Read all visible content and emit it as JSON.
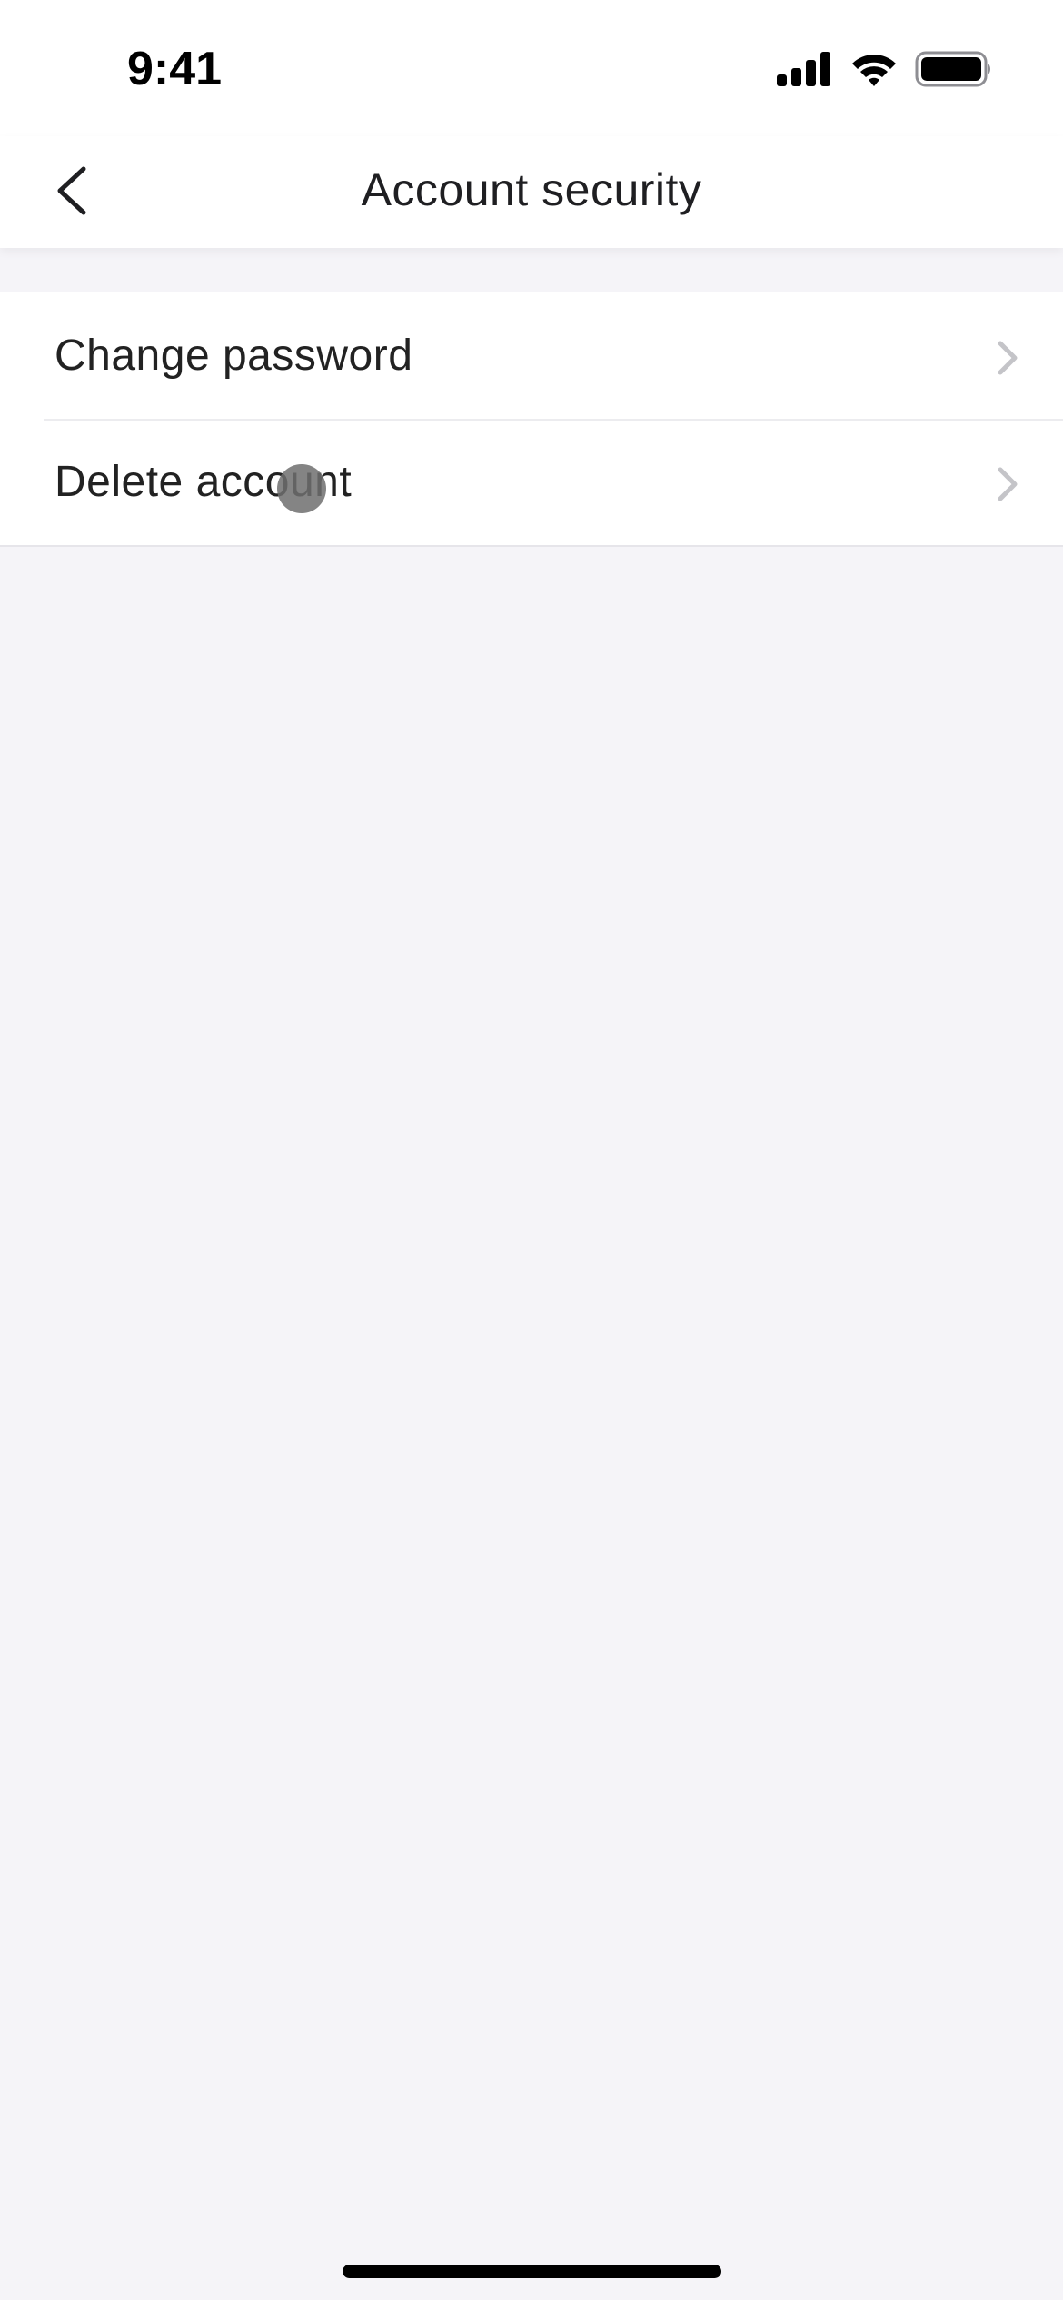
{
  "status_bar": {
    "time": "9:41",
    "icons": [
      "cellular-signal-icon",
      "wifi-icon",
      "battery-icon"
    ]
  },
  "nav": {
    "title": "Account security",
    "back_icon": "chevron-left-icon"
  },
  "settings_list": {
    "items": [
      {
        "label": "Change password",
        "icon": "chevron-right-icon"
      },
      {
        "label": "Delete account",
        "icon": "chevron-right-icon"
      }
    ]
  },
  "colors": {
    "background": "#f5f4f8",
    "surface": "#ffffff",
    "text": "#222222",
    "chevron": "#c4c4c8",
    "divider": "#ececef"
  }
}
